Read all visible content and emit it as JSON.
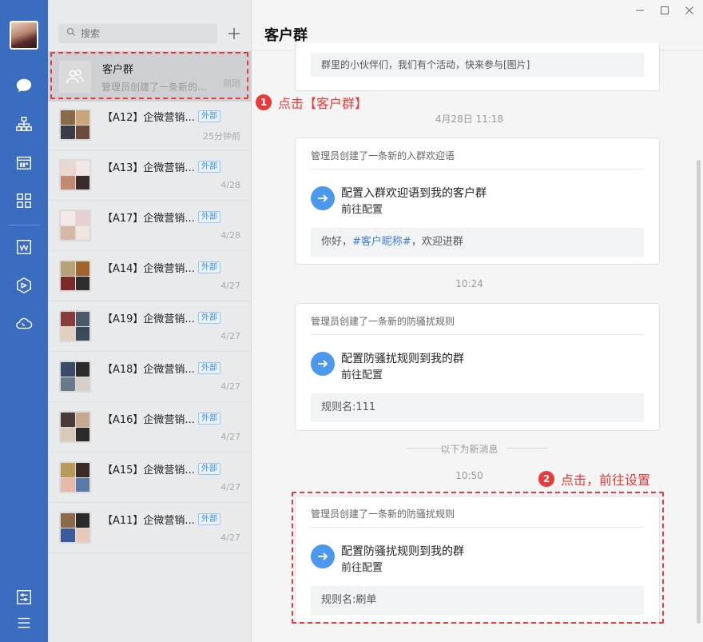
{
  "rail": {
    "items": [
      {
        "name": "messages",
        "icon": "chat-bubble-icon"
      },
      {
        "name": "contacts",
        "icon": "org-chart-icon"
      },
      {
        "name": "calendar",
        "icon": "calendar-icon"
      },
      {
        "name": "workbench",
        "icon": "grid-apps-icon"
      },
      {
        "name": "doc",
        "icon": "doc-icon"
      },
      {
        "name": "drive",
        "icon": "hexagon-icon"
      },
      {
        "name": "meeting",
        "icon": "cloud-phone-icon"
      },
      {
        "name": "settings",
        "icon": "sliders-icon"
      },
      {
        "name": "menu",
        "icon": "hamburger-menu-icon"
      }
    ]
  },
  "search": {
    "placeholder": "搜索"
  },
  "chat_list": [
    {
      "name": "客户群",
      "preview": "管理员创建了一条新的...",
      "time": "刚刚",
      "tag": "",
      "selected": true
    },
    {
      "name": "【A12】企微营销...",
      "preview": "",
      "time": "25分钟前",
      "tag": "外部"
    },
    {
      "name": "【A13】企微营销...",
      "preview": "",
      "time": "4/28",
      "tag": "外部"
    },
    {
      "name": "【A17】企微营销...",
      "preview": "",
      "time": "4/28",
      "tag": "外部"
    },
    {
      "name": "【A14】企微营销...",
      "preview": "",
      "time": "4/27",
      "tag": "外部"
    },
    {
      "name": "【A19】企微营销...",
      "preview": "",
      "time": "4/27",
      "tag": "外部"
    },
    {
      "name": "【A18】企微营销...",
      "preview": "",
      "time": "4/27",
      "tag": "外部"
    },
    {
      "name": "【A16】企微营销...",
      "preview": "",
      "time": "4/27",
      "tag": "外部"
    },
    {
      "name": "【A15】企微营销...",
      "preview": "",
      "time": "4/27",
      "tag": "外部"
    },
    {
      "name": "【A11】企微营销...",
      "preview": "",
      "time": "4/27",
      "tag": "外部"
    }
  ],
  "window": {
    "minimize": "—",
    "maximize": "☐",
    "close": "✕"
  },
  "chat": {
    "title": "客户群",
    "top_partial": "群里的小伙伴们，我们有个活动，快来参与[图片]",
    "stamp1": "4月28日 11:18",
    "card1": {
      "head": "管理员创建了一条新的入群欢迎语",
      "title": "配置入群欢迎语到我的客户群",
      "sub": "前往配置",
      "foot_a": "你好，",
      "foot_hl": "#客户昵称#",
      "foot_b": "，欢迎进群"
    },
    "stamp2": "10:24",
    "card2": {
      "head": "管理员创建了一条新的防骚扰规则",
      "title": "配置防骚扰规则到我的群",
      "sub": "前往配置",
      "foot": "规则名:111"
    },
    "new_divider": "以下为新消息",
    "stamp3": "10:50",
    "card3": {
      "head": "管理员创建了一条新的防骚扰规则",
      "title": "配置防骚扰规则到我的群",
      "sub": "前往配置",
      "foot": "规则名:刷单"
    }
  },
  "annotations": [
    {
      "num": "1",
      "text": "点击【客户群】"
    },
    {
      "num": "2",
      "text": "点击，前往设置"
    }
  ],
  "colors": {
    "rail": "#3a6cc0",
    "accent": "#4c98ef",
    "annotation": "#e83a3a",
    "group_green": "#3ab14a"
  }
}
